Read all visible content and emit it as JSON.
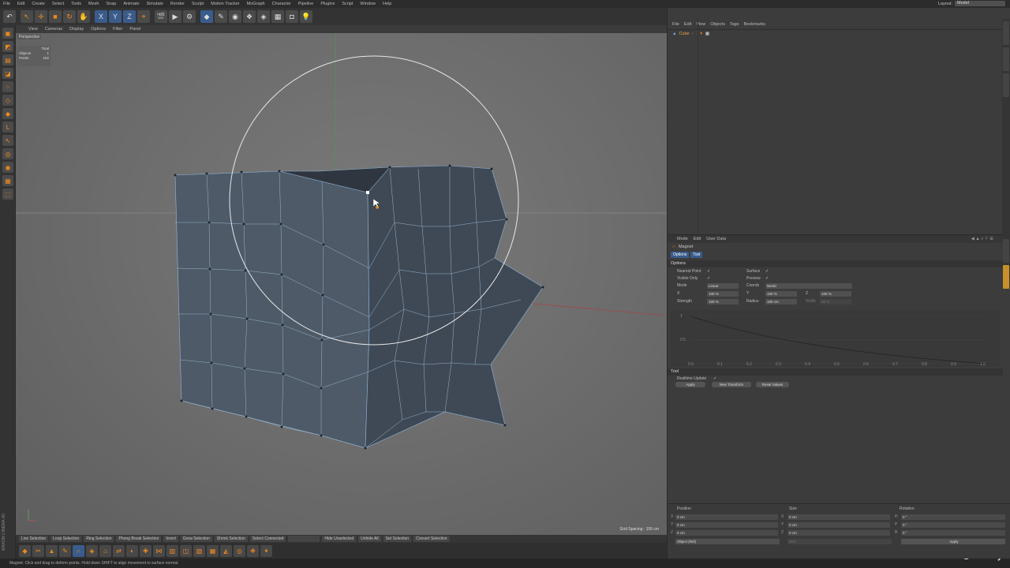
{
  "menubar": {
    "items": [
      "File",
      "Edit",
      "Create",
      "Select",
      "Tools",
      "Mesh",
      "Snap",
      "Animate",
      "Simulate",
      "Render",
      "Sculpt",
      "Motion Tracker",
      "MoGraph",
      "Character",
      "Pipeline",
      "Plugins",
      "Script",
      "Window",
      "Help"
    ],
    "layout_label": "Layout:",
    "layout_value": "Model"
  },
  "toolbar": {
    "axis_x": "X",
    "axis_y": "Y",
    "axis_z": "Z"
  },
  "viewport": {
    "menu": [
      "View",
      "Cameras",
      "Display",
      "Options",
      "Filter",
      "Panel"
    ],
    "label": "Perspective",
    "hud": {
      "header": "Total",
      "objects_label": "Objects",
      "objects_value": "1",
      "points_label": "Points",
      "points_value": "152"
    },
    "grid_spacing": "Grid Spacing : 100 cm"
  },
  "selection_bar": {
    "items": [
      "Live Selection",
      "Loop Selection",
      "Ring Selection",
      "Phong Break Selection",
      "Invert",
      "Grow Selection",
      "Shrink Selection",
      "Select Connected",
      "",
      "Hide Unselected",
      "Unhide All",
      "Set Selection",
      "Convert Selection"
    ]
  },
  "status": "Magnet: Click and drag to deform points. Hold down SHIFT to align movement to surface normal.",
  "brand": "Udemy",
  "object_manager": {
    "menu": [
      "File",
      "Edit",
      "View",
      "Objects",
      "Tags",
      "Bookmarks"
    ],
    "object_name": "Cube"
  },
  "attributes": {
    "menu": [
      "Mode",
      "Edit",
      "User Data"
    ],
    "title": "Magnet",
    "tabs": [
      "Options",
      "Tool"
    ],
    "options_header": "Options",
    "nearest_point": "Nearest Point",
    "visible_only": "Visible Only",
    "surface": "Surface",
    "preview": "Preview",
    "mode_label": "Mode",
    "mode_value": "Linear",
    "coords_label": "Coords",
    "coords_value": "World",
    "x_label": "X",
    "x_value": "100 %",
    "y_label": "Y",
    "y_value": "100 %",
    "z_label": "Z",
    "z_value": "100 %",
    "strength_label": "Strength",
    "strength_value": "100 %",
    "radius_label": "Radius",
    "radius_value": "100 cm",
    "width_label": "Width",
    "width_value": "50 %",
    "graph_y_ticks": [
      "1",
      "0.5"
    ],
    "graph_x_ticks": [
      "0.0",
      "0.1",
      "0.2",
      "0.3",
      "0.4",
      "0.5",
      "0.6",
      "0.7",
      "0.8",
      "0.9",
      "1.0"
    ],
    "tool_header": "Tool",
    "realtime_update": "Realtime Update",
    "apply": "Apply",
    "new_transform": "New Transform",
    "reset_values": "Reset Values"
  },
  "coordinates": {
    "position": "Position",
    "size": "Size",
    "rotation": "Rotation",
    "rows": [
      {
        "axis": "X",
        "pos": "0 cm",
        "size_axis": "X",
        "size": "0 cm",
        "rot_axis": "H",
        "rot": "0 °"
      },
      {
        "axis": "Y",
        "pos": "0 cm",
        "size_axis": "Y",
        "size": "0 cm",
        "rot_axis": "P",
        "rot": "0 °"
      },
      {
        "axis": "Z",
        "pos": "0 cm",
        "size_axis": "Z",
        "size": "0 cm",
        "rot_axis": "B",
        "rot": "0 °"
      }
    ],
    "object_mode": "Object (Rel)",
    "size_mode": "Size",
    "apply": "Apply"
  },
  "colors": {
    "accent_orange": "#f08a1e",
    "selected_blue": "#3a5c8c",
    "mesh_face": "#4a5663"
  }
}
